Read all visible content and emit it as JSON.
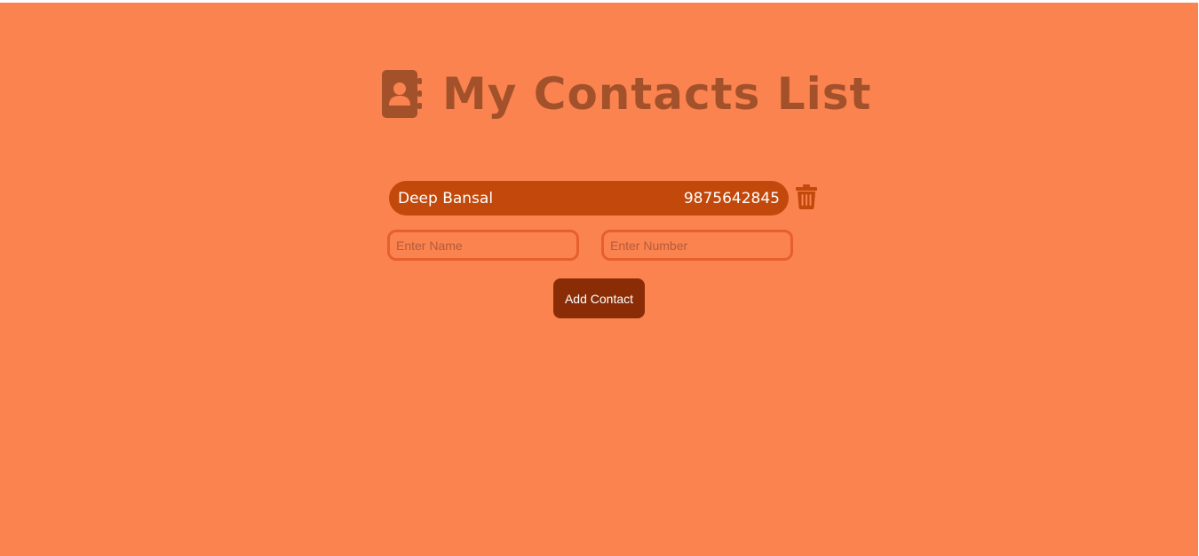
{
  "header": {
    "title": "My Contacts List",
    "icon": "address-book-icon"
  },
  "contacts": [
    {
      "name": "Deep Bansal",
      "number": "9875642845",
      "delete_icon": "trash-icon"
    }
  ],
  "form": {
    "name_placeholder": "Enter Name",
    "name_value": "",
    "number_placeholder": "Enter Number",
    "number_value": "",
    "submit_label": "Add Contact"
  },
  "colors": {
    "background": "#fa834f",
    "title": "#a3512b",
    "contact_row": "#c2490b",
    "input_border": "#e65f2c",
    "button": "#8a2d06",
    "trash": "#c2490b"
  }
}
